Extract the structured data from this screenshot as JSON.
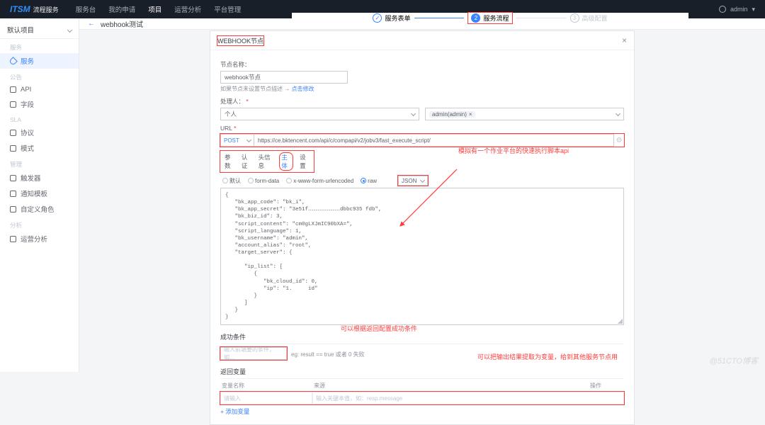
{
  "topbar": {
    "brand": "ITSM",
    "brand_sub": "流程服务",
    "nav": [
      "服务台",
      "我的申请",
      "项目",
      "运营分析",
      "平台管理"
    ],
    "active_index": 2,
    "user": "admin"
  },
  "sidebar": {
    "project": "默认项目",
    "groups": [
      {
        "title": "服务",
        "items": [
          {
            "label": "服务",
            "active": true
          }
        ]
      },
      {
        "title": "公告",
        "items": [
          {
            "label": "API"
          },
          {
            "label": "字段"
          }
        ]
      },
      {
        "title": "SLA",
        "items": [
          {
            "label": "协议"
          },
          {
            "label": "模式"
          }
        ]
      },
      {
        "title": "管理",
        "items": [
          {
            "label": "触发器"
          },
          {
            "label": "通知模板"
          },
          {
            "label": "自定义角色"
          }
        ]
      },
      {
        "title": "分析",
        "items": [
          {
            "label": "运营分析"
          }
        ]
      }
    ]
  },
  "breadcrumb": {
    "back": "←",
    "title": "webhook测试"
  },
  "steps": [
    {
      "num": "✓",
      "label": "服务表单",
      "state": "done"
    },
    {
      "num": "2",
      "label": "服务流程",
      "state": "cur"
    },
    {
      "num": "3",
      "label": "高级配置",
      "state": "todo"
    }
  ],
  "modal": {
    "title": "WEBHOOK节点",
    "nodeNameLabel": "节点名称：",
    "nodeNameValue": "webhook节点",
    "nodeHint_pre": "如果节点未设置节点描述 → ",
    "nodeHint_link": "点击修改",
    "handlerLabel": "处理人：",
    "handlerType": "个人",
    "handlerValue": "admin(admin)",
    "urlLabel": "URL",
    "method": "POST",
    "url": "https://ce.bktencent.com/api/c/compapi/v2/jobv3/fast_execute_script/",
    "tabs": [
      "参数",
      "认证",
      "头信息",
      "主体",
      "设置"
    ],
    "tabs_active": 3,
    "bodyTypes": {
      "options": [
        "默认",
        "form-data",
        "x-www-form-urlencoded",
        "raw"
      ],
      "active": 3,
      "format": "JSON"
    },
    "rawBody": "{\n   \"bk_app_code\": \"bk_i\",\n   \"bk_app_secret\": \"3e51f…………………………dbbc935 fdb\",\n   \"bk_biz_id\": 3,\n   \"script_content\": \"cm0gLXJmIC90bXA=\",\n   \"script_language\": 1,\n   \"bk_username\": \"admin\",\n   \"account_alias\": \"root\",\n   \"target_server\": {\n\n      \"ip_list\": [\n         {\n            \"bk_cloud_id\": 0,\n            \"ip\": \"1.     id\"\n         }\n      ]\n   }\n}",
    "succSectionTitle": "成功条件",
    "succInputPlaceholder": "输入前端要的条件，如…",
    "succHint": "eg: result ==  true 或者 0 失败",
    "returnVarTitle": "返回变量",
    "tableHeaders": {
      "name": "变量名称",
      "source": "来源",
      "op": "操作"
    },
    "varRow": {
      "nameHint": "请输入",
      "srcHint": "输入关键本值，如：resp.message"
    },
    "addVar": "+ 添加变量"
  },
  "annotations": {
    "api": "模拟有一个作业平台的快速执行脚本api",
    "cond": "可以根据返回配置成功条件",
    "var": "可以把输出结果提取为变量，给到其他服务节点用"
  },
  "watermark": "@51CTO博客"
}
